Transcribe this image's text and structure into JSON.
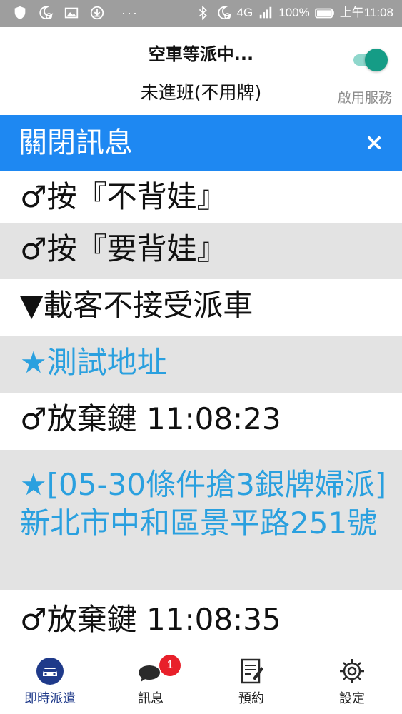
{
  "status_bar": {
    "network": "4G",
    "battery": "100%",
    "time": "上午11:08",
    "left_icons": [
      "shield-icon",
      "moon-clock-icon",
      "image-icon",
      "download-icon"
    ],
    "right_icons": [
      "bluetooth-icon",
      "moon-clock-icon",
      "signal-icon",
      "battery-icon"
    ]
  },
  "header": {
    "title": "空車等派中...",
    "subtitle": "未進班(不用牌)",
    "service_toggle": {
      "label": "啟用服務",
      "on": true
    }
  },
  "close_bar": {
    "label": "關閉訊息"
  },
  "messages": [
    {
      "text": "♂按『不背娃』"
    },
    {
      "text": "♂按『要背娃』"
    },
    {
      "text": "▼載客不接受派車"
    },
    {
      "text": "★測試地址"
    },
    {
      "text": "♂放棄鍵 11:08:23"
    },
    {
      "text": "★[05-30條件搶3銀牌婦派]新北市中和區景平路251號"
    },
    {
      "text": "♂放棄鍵 11:08:35"
    }
  ],
  "nav": [
    {
      "label": "即時派遣",
      "icon": "taxi-icon",
      "active": true
    },
    {
      "label": "訊息",
      "icon": "chat-icon",
      "badge": "1"
    },
    {
      "label": "預約",
      "icon": "notepad-icon"
    },
    {
      "label": "設定",
      "icon": "gear-icon"
    }
  ],
  "colors": {
    "primary_blue": "#1e88f2",
    "toggle_green": "#159c86",
    "highlight_text": "#2aa0df",
    "row_gray": "#e3e3e3",
    "badge_red": "#e8202a",
    "nav_active": "#1f3a8a"
  }
}
